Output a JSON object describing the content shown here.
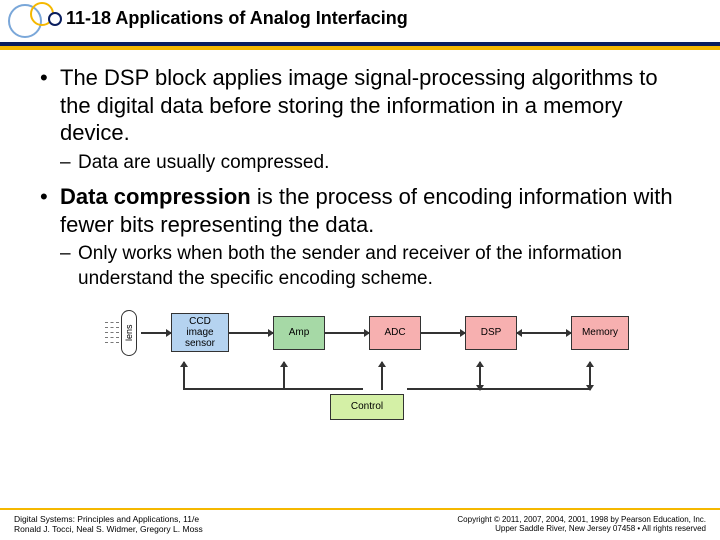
{
  "header": {
    "title": "11-18 Applications of Analog Interfacing"
  },
  "bullets": {
    "p1": "The DSP block applies image signal-processing algorithms to the digital data before storing the information in a memory device.",
    "p1a": "Data are usually compressed.",
    "p2a": "Data compression",
    "p2b": " is the process of encoding information with fewer bits representing the data.",
    "p2sub": "Only works when both the sender and receiver of the information understand the specific encoding scheme."
  },
  "diagram": {
    "lens": "lens",
    "ccd": "CCD image sensor",
    "amp": "Amp",
    "adc": "ADC",
    "dsp": "DSP",
    "mem": "Memory",
    "ctrl": "Control"
  },
  "footer": {
    "left1": "Digital Systems: Principles and Applications, 11/e",
    "left2": "Ronald J. Tocci, Neal S. Widmer, Gregory L. Moss",
    "right1": "Copyright © 2011, 2007, 2004, 2001, 1998 by Pearson Education, Inc.",
    "right2": "Upper Saddle River, New Jersey 07458 • All rights reserved"
  }
}
